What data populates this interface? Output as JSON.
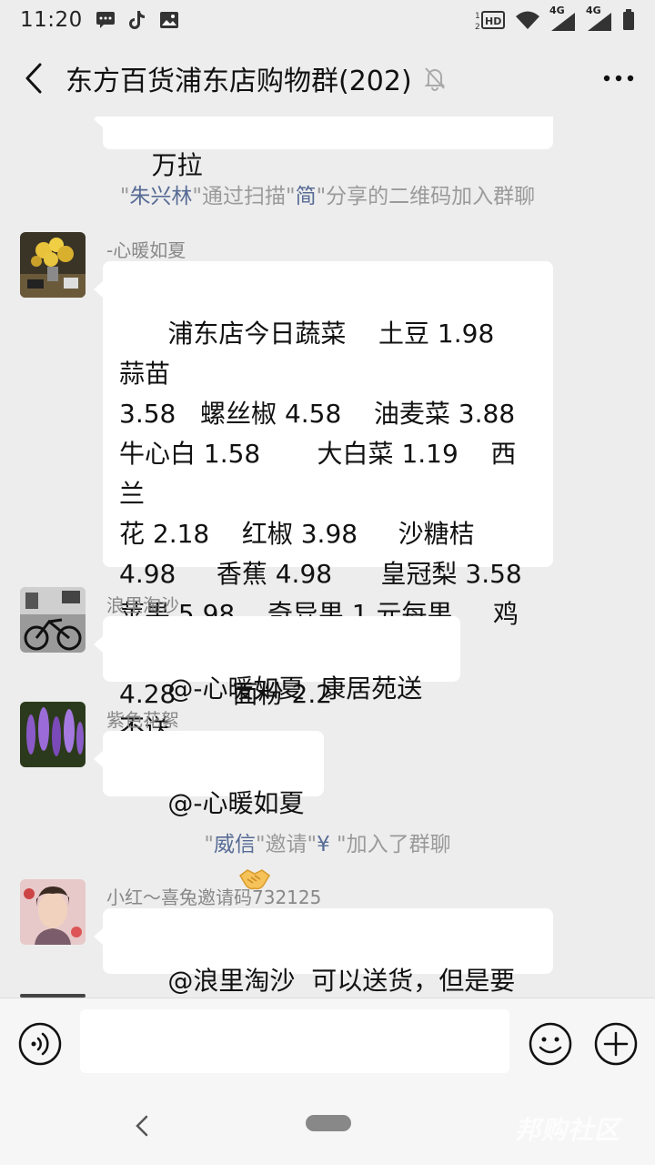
{
  "status_bar": {
    "time": "11:20",
    "network_1": "4G",
    "network_2": "4G"
  },
  "header": {
    "title": "东方百货浦东店购物群(202)"
  },
  "messages": {
    "partial_text": "万拉",
    "sys1": {
      "q1": "\"",
      "name1": "朱兴林",
      "mid": "\"通过扫描\"",
      "name2": "简",
      "tail": "\"分享的二维码加入群聊"
    },
    "m1": {
      "sender": "-心暖如夏",
      "text": "浦东店今日蔬菜    土豆 1.98   蒜苗\n3.58   螺丝椒 4.58    油麦菜 3.88\n牛心白 1.58       大白菜 1.19    西兰\n花 2.18    红椒 3.98     沙糖桔\n4.98     香蕉 4.98      皇冠梨 3.58\n苹果 5.98    奇异果 1 元每果     鸡蛋\n4.28       面粉 2.2"
    },
    "m2": {
      "sender": "浪里淘沙",
      "text": "@-心暖如夏  康居苑送不送"
    },
    "m3": {
      "sender": "紫色花絮",
      "text": "@-心暖如夏 "
    },
    "sys2": {
      "q1": "\"",
      "name1": "威信",
      "mid": "\"邀请\"",
      "name2": "¥",
      "tail": " \"加入了群聊"
    },
    "m4": {
      "sender": "小红～喜兔邀请码732125",
      "text": "@浪里淘沙  可以送货，但是要晚点"
    }
  },
  "input": {
    "placeholder": ""
  },
  "watermark": "邦购社区",
  "colors": {
    "background": "#ededed",
    "bubble": "#ffffff",
    "system_name": "#576b95",
    "system_text": "#9a9a9a"
  }
}
